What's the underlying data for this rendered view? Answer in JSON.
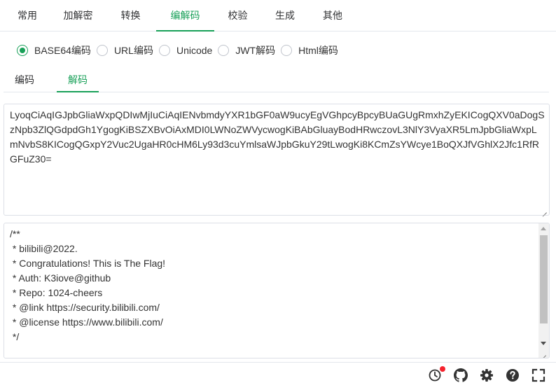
{
  "top_tabs": [
    {
      "label": "常用",
      "active": true
    },
    {
      "label": "加解密",
      "active": false
    },
    {
      "label": "转换",
      "active": false
    },
    {
      "label": "编解码",
      "active": false
    },
    {
      "label": "校验",
      "active": false
    },
    {
      "label": "生成",
      "active": false
    },
    {
      "label": "其他",
      "active": false
    }
  ],
  "radio_options": [
    {
      "label": "BASE64编码",
      "checked": true
    },
    {
      "label": "URL编码",
      "checked": false
    },
    {
      "label": "Unicode",
      "checked": false
    },
    {
      "label": "JWT解码",
      "checked": false
    },
    {
      "label": "Html编码",
      "checked": false
    }
  ],
  "sub_tabs": [
    {
      "label": "编码",
      "active": false
    },
    {
      "label": "解码",
      "active": true
    }
  ],
  "input": {
    "value": "LyoqCiAqIGJpbGliaWxpQDIwMjIuCiAqIENvbmdyYXR1bGF0aW9ucyEgVGhpcyBpcyBUaGUgRmxhZyEKICogQXV0aDogSzNpb3ZlQGdpdGh1YgogKiBSZXBvOiAxMDI0LWNoZWVycwogKiBAbGluayBodHRwczovL3NlY3VyaXR5LmJpbGliaWxpLmNvbS8KICogQGxpY2Vuc2UgaHR0cHM6Ly93d3cuYmlsaWJpbGkuY29tLwogKi8KCmZsYWcye1BoQXJfVGhlX2Jfc1RfRGFuZ30="
  },
  "output": {
    "lines": [
      "/**",
      " * bilibili@2022.",
      " * Congratulations! This is The Flag!",
      " * Auth: K3iove@github",
      " * Repo: 1024-cheers",
      " * @link https://security.bilibili.com/",
      " * @license https://www.bilibili.com/",
      " */"
    ]
  },
  "footer": {
    "icons": [
      "history-icon",
      "github-icon",
      "settings-icon",
      "help-icon",
      "fullscreen-icon"
    ],
    "notification_color": "#f5222d"
  },
  "colors": {
    "accent": "#18a058",
    "border": "#dcdfe6"
  }
}
